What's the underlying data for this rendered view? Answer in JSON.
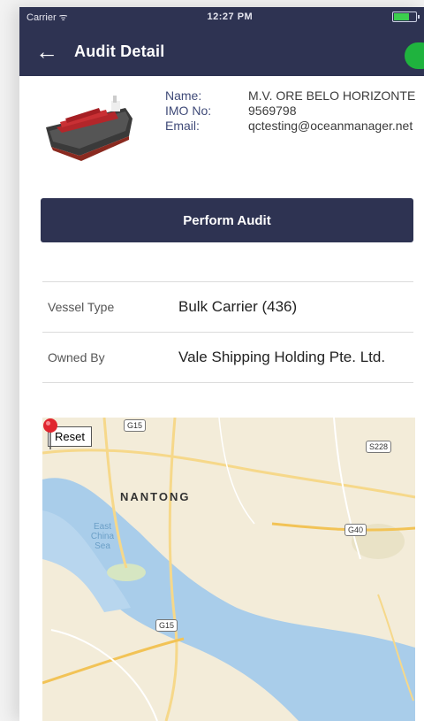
{
  "status_bar": {
    "carrier": "Carrier ᯤ",
    "time": "12:27 PM"
  },
  "header": {
    "title": "Audit Detail",
    "back_icon": "←"
  },
  "vessel": {
    "name_label": "Name:",
    "name_value": "M.V. ORE BELO HORIZONTE",
    "imo_label": "IMO No:",
    "imo_value": "9569798",
    "email_label": "Email:",
    "email_value": "qctesting@oceanmanager.net"
  },
  "actions": {
    "perform_audit": "Perform Audit"
  },
  "details": [
    {
      "label": "Vessel Type",
      "value": "Bulk Carrier (436)"
    },
    {
      "label": "Owned By",
      "value": "Vale Shipping Holding Pte. Ltd."
    }
  ],
  "map": {
    "reset_label": "Reset",
    "city": "NANTONG",
    "sea": "East China Sea",
    "road_shields": [
      "G15",
      "S228",
      "G40",
      "G15"
    ]
  },
  "colors": {
    "navbar": "#2e3352",
    "toggle": "#1fb33e",
    "water": "#a9cdea",
    "land": "#f3ecd9",
    "pin": "#e0262e"
  }
}
